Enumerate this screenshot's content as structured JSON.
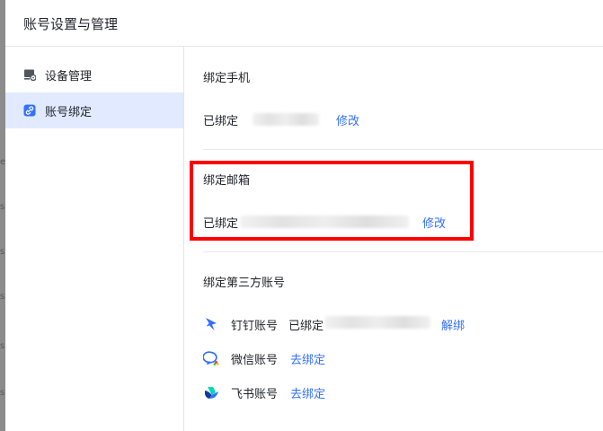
{
  "dialog": {
    "title": "账号设置与管理"
  },
  "sidebar": {
    "items": [
      {
        "label": "设备管理",
        "icon": "device-icon",
        "active": false
      },
      {
        "label": "账号绑定",
        "icon": "link-icon",
        "active": true
      }
    ]
  },
  "phone": {
    "title": "绑定手机",
    "status": "已绑定",
    "action": "修改"
  },
  "email": {
    "title": "绑定邮箱",
    "status": "已绑定",
    "action": "修改"
  },
  "third_party": {
    "title": "绑定第三方账号",
    "items": [
      {
        "name": "钉钉账号",
        "status": "已绑定",
        "action": "解绑",
        "icon": "dingtalk-icon"
      },
      {
        "name": "微信账号",
        "action": "去绑定",
        "icon": "wechat-icon"
      },
      {
        "name": "飞书账号",
        "action": "去绑定",
        "icon": "feishu-icon"
      }
    ]
  },
  "colors": {
    "accent": "#3370ff",
    "active_bg": "#e1eaff",
    "highlight": "#ff0000"
  }
}
